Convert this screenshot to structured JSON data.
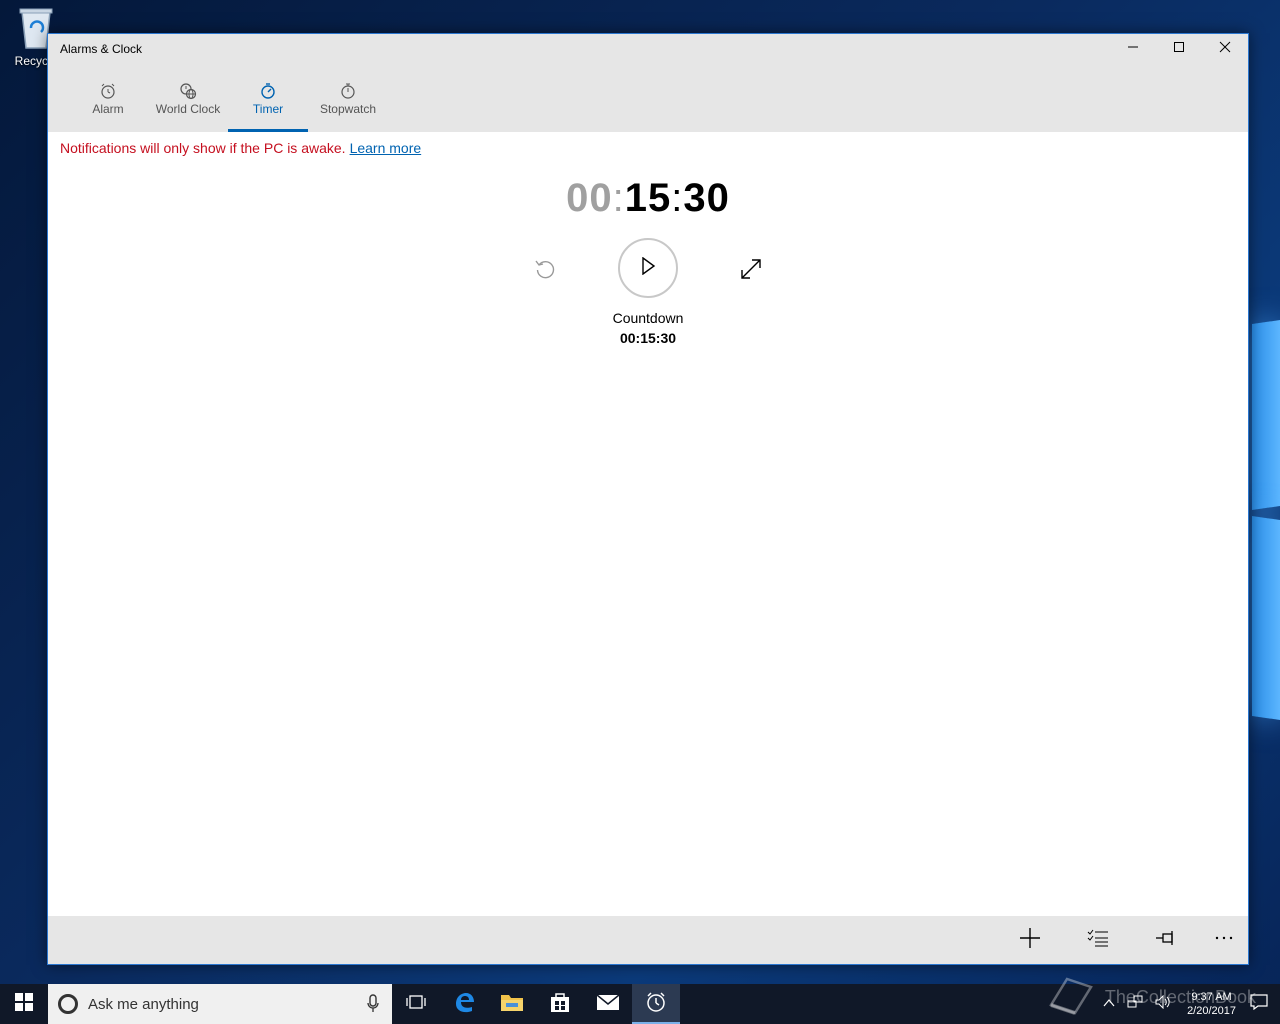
{
  "desktop": {
    "recycle_bin_label": "Recycle"
  },
  "window": {
    "title": "Alarms & Clock",
    "minimize_icon": "minimize-icon",
    "maximize_icon": "maximize-icon",
    "close_icon": "close-icon"
  },
  "tabs": [
    {
      "label": "Alarm",
      "icon": "alarm-clock-icon",
      "active": false
    },
    {
      "label": "World Clock",
      "icon": "world-clock-icon",
      "active": false
    },
    {
      "label": "Timer",
      "icon": "timer-icon",
      "active": true
    },
    {
      "label": "Stopwatch",
      "icon": "stopwatch-icon",
      "active": false
    }
  ],
  "notice": {
    "text": "Notifications will only show if the PC is awake.",
    "link": "Learn more"
  },
  "timer": {
    "hours": "00",
    "minutes": "15",
    "seconds": "30",
    "separator": ":",
    "name": "Countdown",
    "remaining": "00:15:30"
  },
  "commandbar": {
    "buttons": [
      "add-icon",
      "select-list-icon",
      "pin-icon",
      "more-icon"
    ]
  },
  "taskbar": {
    "search_placeholder": "Ask me anything",
    "time": "9:37 AM",
    "date": "2/20/2017"
  },
  "watermark": {
    "text": "TheCollectionBook"
  },
  "colors": {
    "accent": "#0063b1",
    "notice_red": "#c50f1f",
    "chrome_gray": "#e6e6e6"
  }
}
